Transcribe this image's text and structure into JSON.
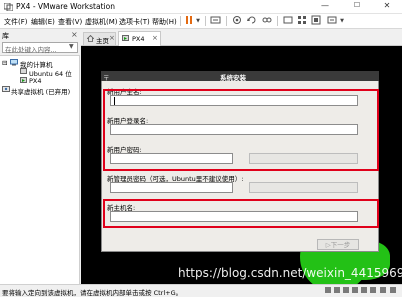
{
  "window": {
    "title": "PX4 - VMware Workstation",
    "controls": {
      "minimize": "—",
      "maximize": "☐",
      "close": "✕"
    }
  },
  "menu": {
    "items": [
      "文件(F)",
      "编辑(E)",
      "查看(V)",
      "虚拟机(M)",
      "选项卡(T)",
      "帮助(H)"
    ],
    "toolbar_icons": [
      "pause-icon",
      "dropdown-icon",
      "send-keys-icon",
      "snapshot-icon",
      "revert-snapshot-icon",
      "manage-snapshots-icon",
      "fullscreen-icon",
      "unity-icon",
      "console-view-icon",
      "stretch-icon"
    ]
  },
  "library": {
    "title": "库",
    "close": "×",
    "search_placeholder": "在此处键入内容...",
    "tree": [
      {
        "label": "我的计算机",
        "expander": "⊟"
      },
      {
        "label": "Ubuntu 64 位"
      },
      {
        "label": "PX4"
      },
      {
        "label": "共享虚拟机 (已弃用)"
      }
    ]
  },
  "tabs": [
    {
      "label": "主页",
      "close": "×"
    },
    {
      "label": "PX4",
      "close": "×"
    }
  ],
  "installer": {
    "title": "系统安装",
    "pin": "〒",
    "fields": {
      "username_label": "新用户全名:",
      "username_value": "",
      "login_label": "新用户登录名:",
      "login_value": "",
      "password_label": "新用户密码:",
      "password_value": "",
      "password_confirm_value": "",
      "admin_password_label": "新管理员密码（可选，Ubuntu里不建议使用）:",
      "admin_password_value": "",
      "admin_password_confirm_value": "",
      "hostname_label": "新主机名:",
      "hostname_value": ""
    },
    "next_label": "▷下一步"
  },
  "watermark": "https://blog.csdn.net/weixin_44159697",
  "status_bar": {
    "text": "要将输入定向到该虚拟机，请在虚拟机内部单击或按 Ctrl+G。"
  },
  "colors": {
    "highlight_frame": "#e0001a",
    "pause_button": "#e36a12",
    "vm_background": "#000000",
    "desktop_shape": "#23c116"
  }
}
